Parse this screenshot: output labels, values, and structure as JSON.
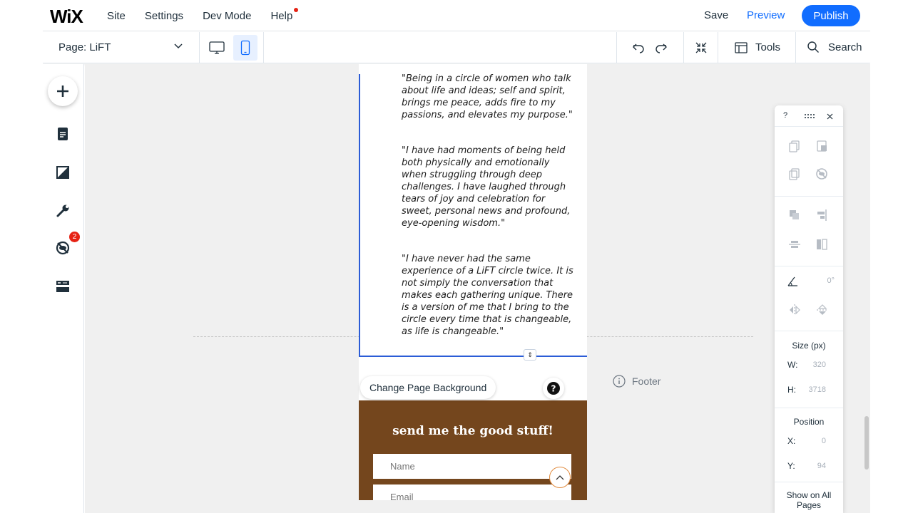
{
  "topbar": {
    "logo": "WiX",
    "nav": [
      "Site",
      "Settings",
      "Dev Mode",
      "Help"
    ],
    "save": "Save",
    "preview": "Preview",
    "publish": "Publish"
  },
  "toolbar": {
    "page_label": "Page: LiFT",
    "tools": "Tools",
    "search": "Search"
  },
  "left_rail": {
    "badge_count": "2"
  },
  "canvas": {
    "quotes": [
      "\"Being in a circle of women who talk about life and ideas; self and spirit, brings me peace, adds fire to my passions, and elevates my purpose.\"",
      "\"I have had moments of being held both physically and emotionally when struggling through deep challenges. I have laughed through tears of joy and celebration for sweet, personal news and profound, eye-opening wisdom.\"",
      "\"I have never had the same experience of a LiFT circle twice. It is not simply the conversation that makes each gathering unique. There is a version of me that I bring to the circle every time that is changeable, as life is changeable.\""
    ],
    "change_background": "Change Page Background",
    "help_glyph": "?",
    "footer_label": "Footer",
    "footer_title": "send me the good stuff!",
    "name_placeholder": "Name",
    "email_placeholder": "Email"
  },
  "right_panel": {
    "help_glyph": "?",
    "rotation": "0°",
    "size_title": "Size (px)",
    "w_key": "W:",
    "w_val": "320",
    "h_key": "H:",
    "h_val": "3718",
    "position_title": "Position",
    "x_key": "X:",
    "x_val": "0",
    "y_key": "Y:",
    "y_val": "94",
    "show_all": "Show on All Pages"
  },
  "colors": {
    "accent": "#116dff",
    "selection": "#2b5cd6",
    "footer_brown": "#74461d",
    "badge_red": "#e62214"
  }
}
